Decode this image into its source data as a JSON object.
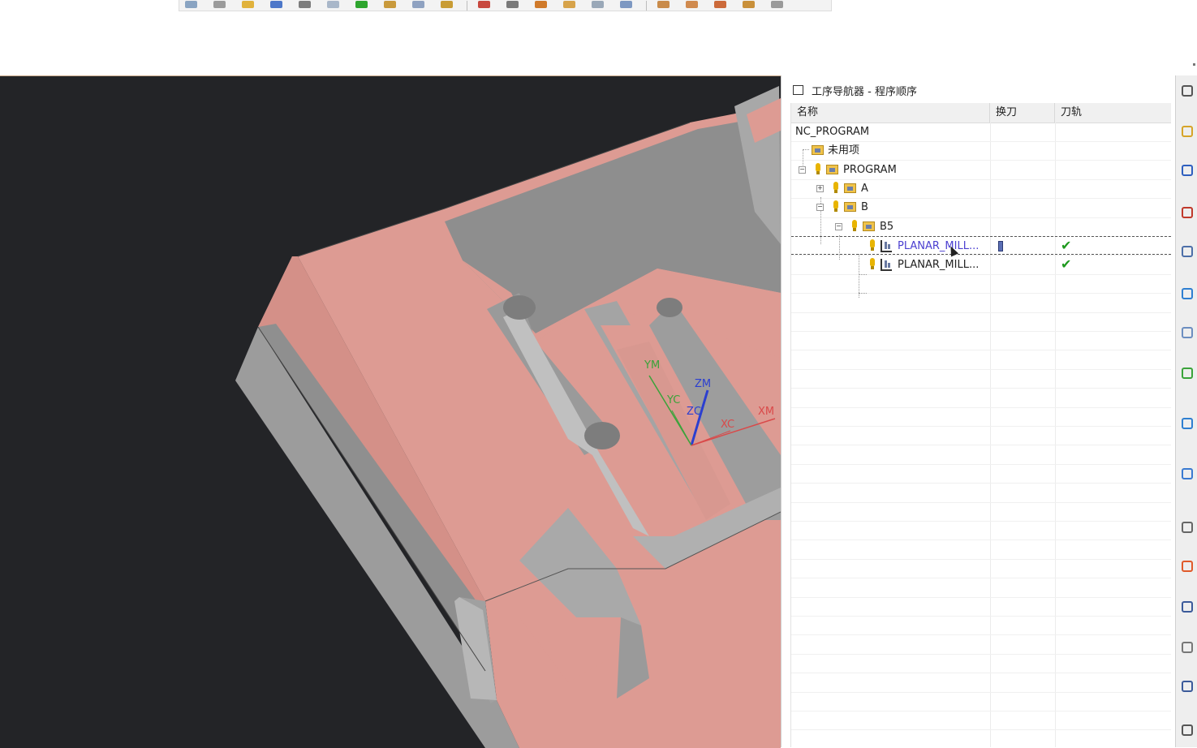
{
  "toolbar": {
    "icons": [
      "mesh-view-icon",
      "surface-icon",
      "tool-icon",
      "create-tool-icon",
      "edit-tool-icon",
      "list-icon",
      "verify-check-icon",
      "layout-icon",
      "copy-icon",
      "geometry-box-icon",
      "display-icon",
      "image-icon",
      "cut-icon",
      "refresh-icon",
      "sheet-icon",
      "wrench-icon",
      "post-process-icon",
      "shop-doc-icon",
      "tool-delete-icon",
      "export-icon",
      "more-dropdown-icon"
    ],
    "colors": [
      "#8aa4c2",
      "#9b9b9b",
      "#e1b23c",
      "#4d77c9",
      "#7c7c7c",
      "#a9b7c9",
      "#2ea52e",
      "#c99a3c",
      "#8fa2c1",
      "#c99c35",
      "#c8483e",
      "#7a7a7a",
      "#d07a2a",
      "#d7a34a",
      "#9aa8b8",
      "#7d98c2",
      "#c98b4a",
      "#d08a4e",
      "#cc6a3a",
      "#c9903a",
      "#9a9a9a"
    ]
  },
  "viewport": {
    "background": "#232427",
    "part_top_color": "#dd9b93",
    "part_side_color": "#a9a9a9",
    "axis_labels": {
      "ym": "YM",
      "yc": "YC",
      "zm": "ZM",
      "zc": "ZC",
      "xc": "XC",
      "xm": "XM"
    }
  },
  "navigator": {
    "title": "工序导航器 - 程序顺序",
    "columns": {
      "name": "名称",
      "tool_change": "换刀",
      "path": "刀轨"
    },
    "rows": [
      {
        "label": "NC_PROGRAM"
      },
      {
        "label": "未用项"
      },
      {
        "label": "PROGRAM"
      },
      {
        "label": "A"
      },
      {
        "label": "B"
      },
      {
        "label": "B5"
      },
      {
        "label": "PLANAR_MILL...",
        "tool_change": true,
        "path_ok": true
      },
      {
        "label": "PLANAR_MILL...",
        "path_ok": false
      }
    ],
    "check_mark": "✔"
  },
  "resource_bar": {
    "icons": [
      "settings-gear-icon",
      "program-order-icon",
      "machine-tool-icon",
      "geometry-view-icon",
      "operation-nav-icon",
      "mesh-icon",
      "machine-icon",
      "library-icon",
      "info-icon",
      "document-icon",
      "history-clock-icon",
      "color-bar-icon",
      "tool-list-icon",
      "wrench-icon",
      "report-icon",
      "list-icon"
    ]
  }
}
